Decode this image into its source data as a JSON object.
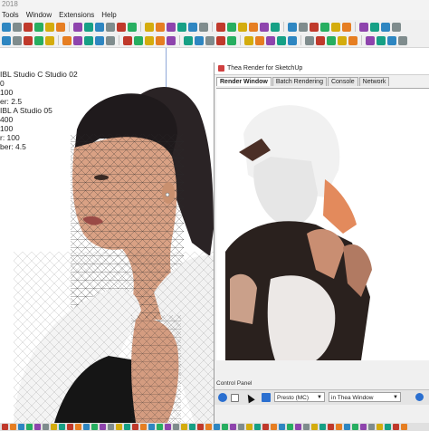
{
  "app": {
    "title_fragment": "2018"
  },
  "menu": {
    "items": [
      "Tools",
      "Window",
      "Extensions",
      "Help"
    ]
  },
  "info_panel": {
    "lines": [
      "IBL Studio C Studio 02",
      "0",
      "100",
      "er: 2.5",
      "IBL A Studio 05",
      "400",
      "100",
      "r: 100",
      "ber: 4.5"
    ]
  },
  "thea_window": {
    "title": "Thea Render for SketchUp",
    "tabs": [
      "Render Window",
      "Batch Rendering",
      "Console",
      "Network"
    ],
    "active_tab": "Render Window",
    "control_panel_label": "Control Panel",
    "engine_select": "Presto (MC)",
    "target_select": "in Thea Window"
  },
  "colors": {
    "toolbar_bg": "#f0f0f0",
    "play_button": "#2a6fd0",
    "thea_logo": "#d04040",
    "mesh_edges": "#2b2b2b"
  }
}
